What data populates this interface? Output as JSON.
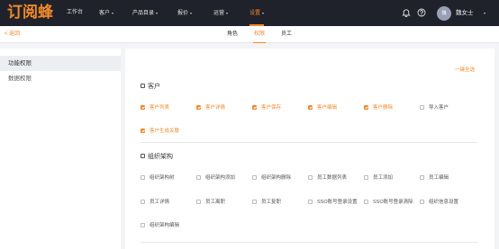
{
  "app": {
    "logo_text": "订阅蜂"
  },
  "topnav": {
    "items": [
      {
        "label": "工作台"
      },
      {
        "label": "客户",
        "caret": "▾"
      },
      {
        "label": "产品目录",
        "caret": "▾"
      },
      {
        "label": "报价",
        "caret": "▾"
      },
      {
        "label": "运营",
        "caret": "▾"
      },
      {
        "label": "设置",
        "caret": "▾",
        "active": true
      }
    ],
    "notification_icon": "bell-icon",
    "help_icon": "help-circle-icon",
    "user": {
      "avatar_text": "魏",
      "name": "魏女士",
      "caret": "▾"
    }
  },
  "subbar": {
    "back_label": "< 返回",
    "tabs": [
      {
        "label": "角色"
      },
      {
        "label": "权限",
        "active": true
      },
      {
        "label": "员工"
      }
    ]
  },
  "sidebar": {
    "items": [
      {
        "label": "功能权限",
        "active": true
      },
      {
        "label": "数据权限"
      }
    ]
  },
  "main": {
    "select_all_label": "一键全选",
    "sections": [
      {
        "title": "客户",
        "checked": false,
        "permissions": [
          {
            "label": "客户列表",
            "checked": true
          },
          {
            "label": "客户详情",
            "checked": true
          },
          {
            "label": "客户保存",
            "checked": true
          },
          {
            "label": "客户编辑",
            "checked": true
          },
          {
            "label": "客户删除",
            "checked": true
          },
          {
            "label": "导入客户",
            "checked": false
          },
          {
            "label": "客户生成关联",
            "checked": true
          }
        ]
      },
      {
        "title": "组织架构",
        "checked": false,
        "permissions": [
          {
            "label": "组织架构树",
            "checked": false
          },
          {
            "label": "组织架构添加",
            "checked": false
          },
          {
            "label": "组织架构删除",
            "checked": false
          },
          {
            "label": "员工数据列表",
            "checked": false
          },
          {
            "label": "员工添加",
            "checked": false
          },
          {
            "label": "员工编辑",
            "checked": false
          },
          {
            "label": "员工详情",
            "checked": false
          },
          {
            "label": "员工离职",
            "checked": false
          },
          {
            "label": "员工复职",
            "checked": false
          },
          {
            "label": "SSO账号登录设置",
            "checked": false
          },
          {
            "label": "SSO账号登录清除",
            "checked": false
          },
          {
            "label": "组织信息设置",
            "checked": false
          },
          {
            "label": "组织架构编辑",
            "checked": false
          }
        ]
      }
    ]
  },
  "colors": {
    "accent": "#f0892b",
    "topbar_bg": "#20222b",
    "page_bg": "#f3f4f6"
  }
}
